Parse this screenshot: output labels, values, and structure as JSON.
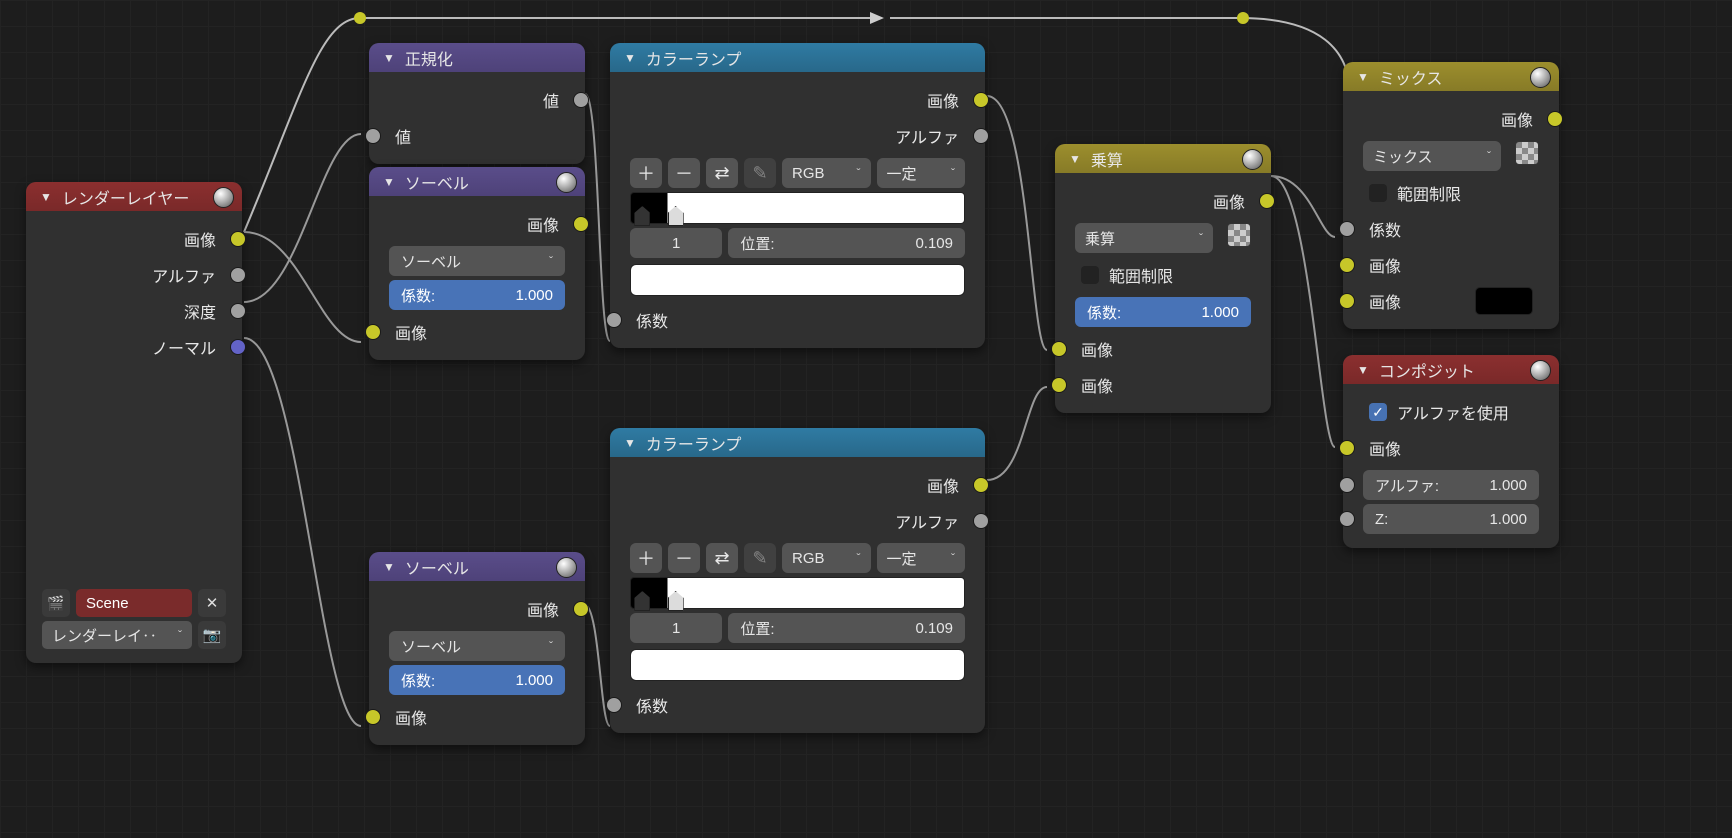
{
  "renderLayers": {
    "title": "レンダーレイヤー",
    "out": {
      "image": "画像",
      "alpha": "アルファ",
      "depth": "深度",
      "normal": "ノーマル"
    },
    "scene": "Scene",
    "layerSel": "レンダーレイ‥"
  },
  "normalize": {
    "title": "正規化",
    "out_value": "値",
    "in_value": "値"
  },
  "sobel": {
    "title": "ソーベル",
    "out_image": "画像",
    "mode": "ソーベル",
    "factor_label": "係数:",
    "factor_value": "1.000",
    "in_image": "画像"
  },
  "colorramp": {
    "title": "カラーランプ",
    "out_image": "画像",
    "out_alpha": "アルファ",
    "mode": "RGB",
    "interp": "一定",
    "idx": "1",
    "pos_label": "位置:",
    "pos_value": "0.109",
    "in_factor": "係数"
  },
  "multiply": {
    "title": "乗算",
    "out_image": "画像",
    "mode": "乗算",
    "clamp": "範囲制限",
    "factor_label": "係数:",
    "factor_value": "1.000",
    "in_image": "画像"
  },
  "mix": {
    "title": "ミックス",
    "out_image": "画像",
    "mode": "ミックス",
    "clamp": "範囲制限",
    "in_factor": "係数",
    "in_image": "画像"
  },
  "composite": {
    "title": "コンポジット",
    "use_alpha": "アルファを使用",
    "in_image": "画像",
    "alpha_label": "アルファ:",
    "alpha_value": "1.000",
    "z_label": "Z:",
    "z_value": "1.000"
  },
  "icons": {
    "plus": "＋",
    "minus": "－",
    "swap": "⇄",
    "picker": "✎"
  }
}
